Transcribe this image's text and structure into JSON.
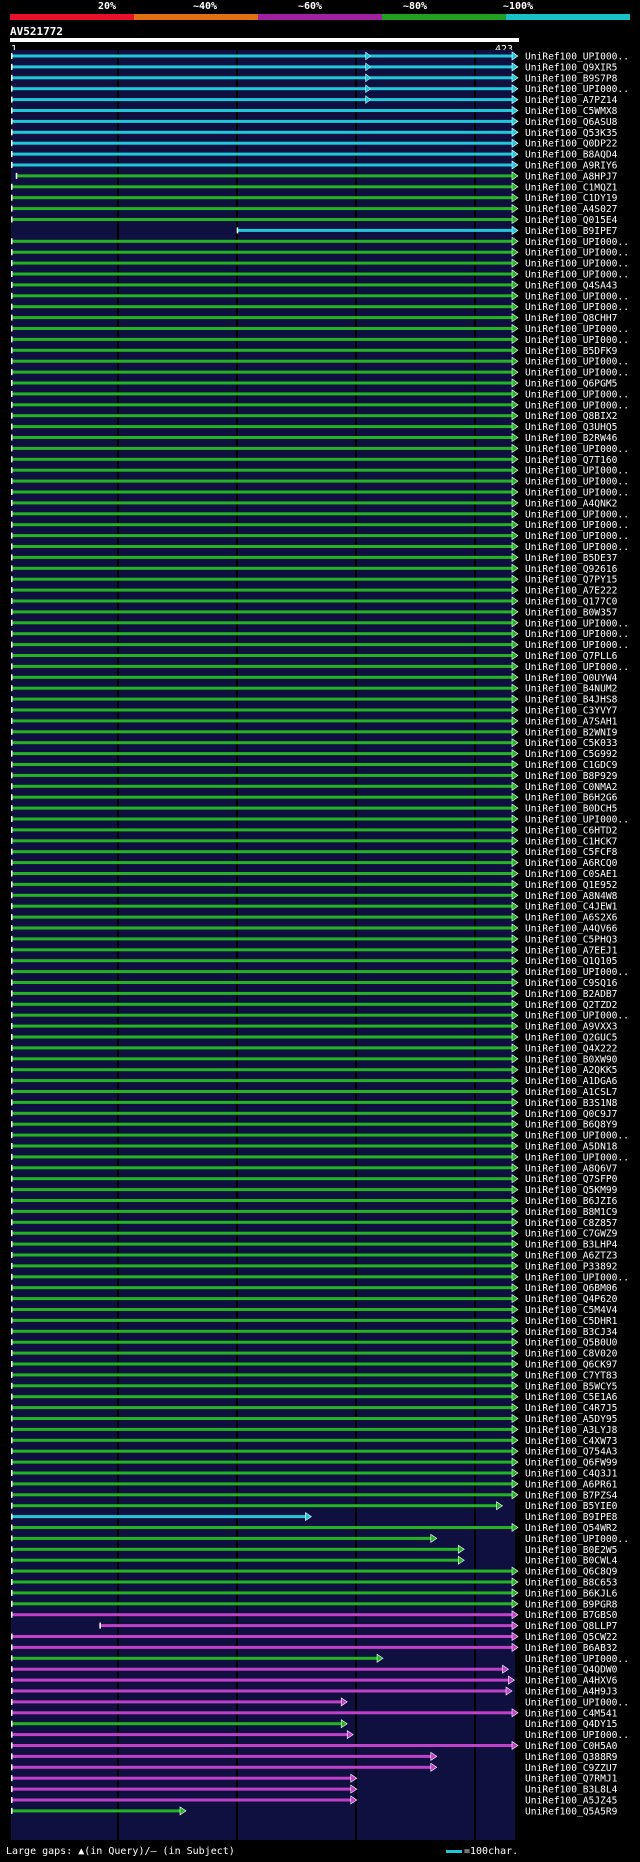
{
  "scale": {
    "labels": [
      "20%",
      "~40%",
      "~60%",
      "~80%",
      "~100%"
    ],
    "colors": [
      "#e8102a",
      "#e07010",
      "#a020a0",
      "#20a020",
      "#18c0c8"
    ]
  },
  "query": {
    "name": "AV521772",
    "start": "1",
    "end": "423"
  },
  "colors": {
    "cyan": "#1ec8d8",
    "green": "#22b422",
    "magenta": "#c040c8",
    "white": "#ffffff",
    "navy": "#101040"
  },
  "hits": [
    {
      "name": "UniRef100_UPI000..",
      "color": "cyan",
      "start": 1,
      "end": 423,
      "tri": 300
    },
    {
      "name": "UniRef100_Q9XIR5",
      "color": "cyan",
      "start": 1,
      "end": 423,
      "tri": 300
    },
    {
      "name": "UniRef100_B9S7P8",
      "color": "cyan",
      "start": 1,
      "end": 423,
      "tri": 300
    },
    {
      "name": "UniRef100_UPI000..",
      "color": "cyan",
      "start": 1,
      "end": 423,
      "tri": 300
    },
    {
      "name": "UniRef100_A7PZ14",
      "color": "cyan",
      "start": 1,
      "end": 423,
      "tri": 300
    },
    {
      "name": "UniRef100_C5WMX8",
      "color": "cyan",
      "start": 1,
      "end": 423
    },
    {
      "name": "UniRef100_Q6ASU8",
      "color": "cyan",
      "start": 1,
      "end": 423
    },
    {
      "name": "UniRef100_Q53K35",
      "color": "cyan",
      "start": 1,
      "end": 423
    },
    {
      "name": "UniRef100_Q0DP22",
      "color": "cyan",
      "start": 1,
      "end": 423
    },
    {
      "name": "UniRef100_B8AQD4",
      "color": "cyan",
      "start": 1,
      "end": 423
    },
    {
      "name": "UniRef100_A9RIY6",
      "color": "cyan",
      "start": 1,
      "end": 423
    },
    {
      "name": "UniRef100_A8HPJ7",
      "color": "green",
      "start": 5,
      "end": 423
    },
    {
      "name": "UniRef100_C1MQZ1",
      "color": "green",
      "start": 1,
      "end": 423
    },
    {
      "name": "UniRef100_C1DY19",
      "color": "green",
      "start": 1,
      "end": 423
    },
    {
      "name": "UniRef100_A4S027",
      "color": "green",
      "start": 1,
      "end": 423
    },
    {
      "name": "UniRef100_Q015E4",
      "color": "green",
      "start": 1,
      "end": 423
    },
    {
      "name": "UniRef100_B9IPE7",
      "color": "cyan",
      "start": 190,
      "end": 423
    },
    {
      "name": "UniRef100_UPI000..",
      "color": "green",
      "start": 1,
      "end": 423
    },
    {
      "name": "UniRef100_UPI000..",
      "color": "green",
      "start": 1,
      "end": 423
    },
    {
      "name": "UniRef100_UPI000..",
      "color": "green",
      "start": 1,
      "end": 423
    },
    {
      "name": "UniRef100_UPI000..",
      "color": "green",
      "start": 1,
      "end": 423
    },
    {
      "name": "UniRef100_Q4SA43",
      "color": "green",
      "start": 1,
      "end": 423
    },
    {
      "name": "UniRef100_UPI000..",
      "color": "green",
      "start": 1,
      "end": 423
    },
    {
      "name": "UniRef100_UPI000..",
      "color": "green",
      "start": 1,
      "end": 423
    },
    {
      "name": "UniRef100_Q8CHH7",
      "color": "green",
      "start": 1,
      "end": 423
    },
    {
      "name": "UniRef100_UPI000..",
      "color": "green",
      "start": 1,
      "end": 423
    },
    {
      "name": "UniRef100_UPI000..",
      "color": "green",
      "start": 1,
      "end": 423
    },
    {
      "name": "UniRef100_B5DFK9",
      "color": "green",
      "start": 1,
      "end": 423
    },
    {
      "name": "UniRef100_UPI000..",
      "color": "green",
      "start": 1,
      "end": 423
    },
    {
      "name": "UniRef100_UPI000..",
      "color": "green",
      "start": 1,
      "end": 423
    },
    {
      "name": "UniRef100_Q6PGM5",
      "color": "green",
      "start": 1,
      "end": 423
    },
    {
      "name": "UniRef100_UPI000..",
      "color": "green",
      "start": 1,
      "end": 423
    },
    {
      "name": "UniRef100_UPI000..",
      "color": "green",
      "start": 1,
      "end": 423
    },
    {
      "name": "UniRef100_Q8BIX2",
      "color": "green",
      "start": 1,
      "end": 423
    },
    {
      "name": "UniRef100_Q3UHQ5",
      "color": "green",
      "start": 1,
      "end": 423
    },
    {
      "name": "UniRef100_B2RW46",
      "color": "green",
      "start": 1,
      "end": 423
    },
    {
      "name": "UniRef100_UPI000..",
      "color": "green",
      "start": 1,
      "end": 423
    },
    {
      "name": "UniRef100_Q7T160",
      "color": "green",
      "start": 1,
      "end": 423
    },
    {
      "name": "UniRef100_UPI000..",
      "color": "green",
      "start": 1,
      "end": 423
    },
    {
      "name": "UniRef100_UPI000..",
      "color": "green",
      "start": 1,
      "end": 423
    },
    {
      "name": "UniRef100_UPI000..",
      "color": "green",
      "start": 1,
      "end": 423
    },
    {
      "name": "UniRef100_A4QNK2",
      "color": "green",
      "start": 1,
      "end": 423
    },
    {
      "name": "UniRef100_UPI000..",
      "color": "green",
      "start": 1,
      "end": 423
    },
    {
      "name": "UniRef100_UPI000..",
      "color": "green",
      "start": 1,
      "end": 423
    },
    {
      "name": "UniRef100_UPI000..",
      "color": "green",
      "start": 1,
      "end": 423
    },
    {
      "name": "UniRef100_UPI000..",
      "color": "green",
      "start": 1,
      "end": 423
    },
    {
      "name": "UniRef100_B5DE37",
      "color": "green",
      "start": 1,
      "end": 423
    },
    {
      "name": "UniRef100_Q92616",
      "color": "green",
      "start": 1,
      "end": 423
    },
    {
      "name": "UniRef100_Q7PY15",
      "color": "green",
      "start": 1,
      "end": 423
    },
    {
      "name": "UniRef100_A7E222",
      "color": "green",
      "start": 1,
      "end": 423
    },
    {
      "name": "UniRef100_Q177C0",
      "color": "green",
      "start": 1,
      "end": 423
    },
    {
      "name": "UniRef100_B0W357",
      "color": "green",
      "start": 1,
      "end": 423
    },
    {
      "name": "UniRef100_UPI000..",
      "color": "green",
      "start": 1,
      "end": 423
    },
    {
      "name": "UniRef100_UPI000..",
      "color": "green",
      "start": 1,
      "end": 423
    },
    {
      "name": "UniRef100_UPI000..",
      "color": "green",
      "start": 1,
      "end": 423
    },
    {
      "name": "UniRef100_Q7PLL6",
      "color": "green",
      "start": 1,
      "end": 423
    },
    {
      "name": "UniRef100_UPI000..",
      "color": "green",
      "start": 1,
      "end": 423
    },
    {
      "name": "UniRef100_Q0UYW4",
      "color": "green",
      "start": 1,
      "end": 423
    },
    {
      "name": "UniRef100_B4NUM2",
      "color": "green",
      "start": 1,
      "end": 423
    },
    {
      "name": "UniRef100_B4JHS8",
      "color": "green",
      "start": 1,
      "end": 423
    },
    {
      "name": "UniRef100_C3YVY7",
      "color": "green",
      "start": 1,
      "end": 423
    },
    {
      "name": "UniRef100_A7SAH1",
      "color": "green",
      "start": 1,
      "end": 423
    },
    {
      "name": "UniRef100_B2WNI9",
      "color": "green",
      "start": 1,
      "end": 423
    },
    {
      "name": "UniRef100_C5K033",
      "color": "green",
      "start": 1,
      "end": 423
    },
    {
      "name": "UniRef100_C5G992",
      "color": "green",
      "start": 1,
      "end": 423
    },
    {
      "name": "UniRef100_C1GDC9",
      "color": "green",
      "start": 1,
      "end": 423
    },
    {
      "name": "UniRef100_B8P929",
      "color": "green",
      "start": 1,
      "end": 423
    },
    {
      "name": "UniRef100_C0NMA2",
      "color": "green",
      "start": 1,
      "end": 423
    },
    {
      "name": "UniRef100_B6H2G6",
      "color": "green",
      "start": 1,
      "end": 423
    },
    {
      "name": "UniRef100_B0DCH5",
      "color": "green",
      "start": 1,
      "end": 423
    },
    {
      "name": "UniRef100_UPI000..",
      "color": "green",
      "start": 1,
      "end": 423
    },
    {
      "name": "UniRef100_C6HTD2",
      "color": "green",
      "start": 1,
      "end": 423
    },
    {
      "name": "UniRef100_C1HCK7",
      "color": "green",
      "start": 1,
      "end": 423
    },
    {
      "name": "UniRef100_C5FCF8",
      "color": "green",
      "start": 1,
      "end": 423
    },
    {
      "name": "UniRef100_A6RCQ0",
      "color": "green",
      "start": 1,
      "end": 423
    },
    {
      "name": "UniRef100_C0SAE1",
      "color": "green",
      "start": 1,
      "end": 423
    },
    {
      "name": "UniRef100_Q1E952",
      "color": "green",
      "start": 1,
      "end": 423
    },
    {
      "name": "UniRef100_A8N4W8",
      "color": "green",
      "start": 1,
      "end": 423
    },
    {
      "name": "UniRef100_C4JEW1",
      "color": "green",
      "start": 1,
      "end": 423
    },
    {
      "name": "UniRef100_A6S2X6",
      "color": "green",
      "start": 1,
      "end": 423
    },
    {
      "name": "UniRef100_A4QV66",
      "color": "green",
      "start": 1,
      "end": 423
    },
    {
      "name": "UniRef100_C5PHQ3",
      "color": "green",
      "start": 1,
      "end": 423
    },
    {
      "name": "UniRef100_A7EEJ1",
      "color": "green",
      "start": 1,
      "end": 423
    },
    {
      "name": "UniRef100_Q1Q105",
      "color": "green",
      "start": 1,
      "end": 423
    },
    {
      "name": "UniRef100_UPI000..",
      "color": "green",
      "start": 1,
      "end": 423
    },
    {
      "name": "UniRef100_C9SQ16",
      "color": "green",
      "start": 1,
      "end": 423
    },
    {
      "name": "UniRef100_B2ADB7",
      "color": "green",
      "start": 1,
      "end": 423
    },
    {
      "name": "UniRef100_Q2TZD2",
      "color": "green",
      "start": 1,
      "end": 423
    },
    {
      "name": "UniRef100_UPI000..",
      "color": "green",
      "start": 1,
      "end": 423
    },
    {
      "name": "UniRef100_A9VXX3",
      "color": "green",
      "start": 1,
      "end": 423
    },
    {
      "name": "UniRef100_Q2GUC5",
      "color": "green",
      "start": 1,
      "end": 423
    },
    {
      "name": "UniRef100_Q4X222",
      "color": "green",
      "start": 1,
      "end": 423
    },
    {
      "name": "UniRef100_B0XW90",
      "color": "green",
      "start": 1,
      "end": 423
    },
    {
      "name": "UniRef100_A2QKK5",
      "color": "green",
      "start": 1,
      "end": 423
    },
    {
      "name": "UniRef100_A1DGA6",
      "color": "green",
      "start": 1,
      "end": 423
    },
    {
      "name": "UniRef100_A1CSL7",
      "color": "green",
      "start": 1,
      "end": 423
    },
    {
      "name": "UniRef100_B3S1N8",
      "color": "green",
      "start": 1,
      "end": 423
    },
    {
      "name": "UniRef100_Q0C9J7",
      "color": "green",
      "start": 1,
      "end": 423
    },
    {
      "name": "UniRef100_B6Q8Y9",
      "color": "green",
      "start": 1,
      "end": 423
    },
    {
      "name": "UniRef100_UPI000..",
      "color": "green",
      "start": 1,
      "end": 423
    },
    {
      "name": "UniRef100_A5DN18",
      "color": "green",
      "start": 1,
      "end": 423
    },
    {
      "name": "UniRef100_UPI000..",
      "color": "green",
      "start": 1,
      "end": 423
    },
    {
      "name": "UniRef100_A8Q6V7",
      "color": "green",
      "start": 1,
      "end": 423
    },
    {
      "name": "UniRef100_Q7SFP0",
      "color": "green",
      "start": 1,
      "end": 423
    },
    {
      "name": "UniRef100_Q5KM99",
      "color": "green",
      "start": 1,
      "end": 423
    },
    {
      "name": "UniRef100_B6JZI6",
      "color": "green",
      "start": 1,
      "end": 423
    },
    {
      "name": "UniRef100_B8M1C9",
      "color": "green",
      "start": 1,
      "end": 423
    },
    {
      "name": "UniRef100_C8Z857",
      "color": "green",
      "start": 1,
      "end": 423
    },
    {
      "name": "UniRef100_C7GWZ9",
      "color": "green",
      "start": 1,
      "end": 423
    },
    {
      "name": "UniRef100_B3LHP4",
      "color": "green",
      "start": 1,
      "end": 423
    },
    {
      "name": "UniRef100_A6ZTZ3",
      "color": "green",
      "start": 1,
      "end": 423
    },
    {
      "name": "UniRef100_P33892",
      "color": "green",
      "start": 1,
      "end": 423
    },
    {
      "name": "UniRef100_UPI000..",
      "color": "green",
      "start": 1,
      "end": 423
    },
    {
      "name": "UniRef100_Q6BM06",
      "color": "green",
      "start": 1,
      "end": 423
    },
    {
      "name": "UniRef100_Q4P620",
      "color": "green",
      "start": 1,
      "end": 423
    },
    {
      "name": "UniRef100_C5M4V4",
      "color": "green",
      "start": 1,
      "end": 423
    },
    {
      "name": "UniRef100_C5DHR1",
      "color": "green",
      "start": 1,
      "end": 423
    },
    {
      "name": "UniRef100_B3CJ34",
      "color": "green",
      "start": 1,
      "end": 423
    },
    {
      "name": "UniRef100_Q5B0U0",
      "color": "green",
      "start": 1,
      "end": 423
    },
    {
      "name": "UniRef100_C8V020",
      "color": "green",
      "start": 1,
      "end": 423
    },
    {
      "name": "UniRef100_Q6CK97",
      "color": "green",
      "start": 1,
      "end": 423
    },
    {
      "name": "UniRef100_C7YT83",
      "color": "green",
      "start": 1,
      "end": 423
    },
    {
      "name": "UniRef100_B5WCY5",
      "color": "green",
      "start": 1,
      "end": 423
    },
    {
      "name": "UniRef100_C5E1A6",
      "color": "green",
      "start": 1,
      "end": 423
    },
    {
      "name": "UniRef100_C4R7J5",
      "color": "green",
      "start": 1,
      "end": 423
    },
    {
      "name": "UniRef100_A5DY95",
      "color": "green",
      "start": 1,
      "end": 423
    },
    {
      "name": "UniRef100_A3LYJ8",
      "color": "green",
      "start": 1,
      "end": 423
    },
    {
      "name": "UniRef100_C4XW73",
      "color": "green",
      "start": 1,
      "end": 423
    },
    {
      "name": "UniRef100_Q754A3",
      "color": "green",
      "start": 1,
      "end": 423
    },
    {
      "name": "UniRef100_Q6FW99",
      "color": "green",
      "start": 1,
      "end": 423
    },
    {
      "name": "UniRef100_C4Q3J1",
      "color": "green",
      "start": 1,
      "end": 423
    },
    {
      "name": "UniRef100_A6PR61",
      "color": "green",
      "start": 1,
      "end": 423
    },
    {
      "name": "UniRef100_B7PZS4",
      "color": "green",
      "start": 1,
      "end": 423
    },
    {
      "name": "UniRef100_B5YIE0",
      "color": "green",
      "start": 1,
      "end": 410
    },
    {
      "name": "UniRef100_B9IPE8",
      "color": "cyan",
      "start": 1,
      "end": 250
    },
    {
      "name": "UniRef100_Q54WR2",
      "color": "green",
      "start": 1,
      "end": 423
    },
    {
      "name": "UniRef100_UPI000..",
      "color": "green",
      "start": 1,
      "end": 355
    },
    {
      "name": "UniRef100_B0E2W5",
      "color": "green",
      "start": 1,
      "end": 378
    },
    {
      "name": "UniRef100_B0CWL4",
      "color": "green",
      "start": 1,
      "end": 378
    },
    {
      "name": "UniRef100_Q6C8Q9",
      "color": "green",
      "start": 1,
      "end": 423
    },
    {
      "name": "UniRef100_B8C653",
      "color": "green",
      "start": 1,
      "end": 423
    },
    {
      "name": "UniRef100_B6KJL6",
      "color": "green",
      "start": 1,
      "end": 423
    },
    {
      "name": "UniRef100_B9PGR8",
      "color": "green",
      "start": 1,
      "end": 423
    },
    {
      "name": "UniRef100_B7GBS0",
      "color": "magenta",
      "start": 1,
      "end": 423
    },
    {
      "name": "UniRef100_Q8LLP7",
      "color": "magenta",
      "start": 75,
      "end": 423
    },
    {
      "name": "UniRef100_Q5CW22",
      "color": "magenta",
      "start": 1,
      "end": 423
    },
    {
      "name": "UniRef100_B6AB32",
      "color": "magenta",
      "start": 1,
      "end": 423
    },
    {
      "name": "UniRef100_UPI000..",
      "color": "green",
      "start": 1,
      "end": 310
    },
    {
      "name": "UniRef100_Q4QDW0",
      "color": "magenta",
      "start": 1,
      "end": 415
    },
    {
      "name": "UniRef100_A4HXV6",
      "color": "magenta",
      "start": 1,
      "end": 420
    },
    {
      "name": "UniRef100_A4H9J3",
      "color": "magenta",
      "start": 1,
      "end": 418
    },
    {
      "name": "UniRef100_UPI000..",
      "color": "magenta",
      "start": 1,
      "end": 280
    },
    {
      "name": "UniRef100_C4M541",
      "color": "magenta",
      "start": 1,
      "end": 423
    },
    {
      "name": "UniRef100_Q4DY15",
      "color": "green",
      "start": 1,
      "end": 280
    },
    {
      "name": "UniRef100_UPI000..",
      "color": "magenta",
      "start": 1,
      "end": 285
    },
    {
      "name": "UniRef100_C0H5A0",
      "color": "magenta",
      "start": 1,
      "end": 423
    },
    {
      "name": "UniRef100_Q388R9",
      "color": "magenta",
      "start": 1,
      "end": 355
    },
    {
      "name": "UniRef100_C9ZZU7",
      "color": "magenta",
      "start": 1,
      "end": 355
    },
    {
      "name": "UniRef100_Q7RMJ1",
      "color": "magenta",
      "start": 1,
      "end": 288
    },
    {
      "name": "UniRef100_B3L8L4",
      "color": "magenta",
      "start": 1,
      "end": 288
    },
    {
      "name": "UniRef100_A5JZ45",
      "color": "magenta",
      "start": 1,
      "end": 288
    },
    {
      "name": "UniRef100_Q5A5R9",
      "color": "green",
      "start": 1,
      "end": 145
    }
  ],
  "legend": {
    "left": "Large gaps: ▲(in Query)/– (in Subject)",
    "right": "=100char."
  }
}
